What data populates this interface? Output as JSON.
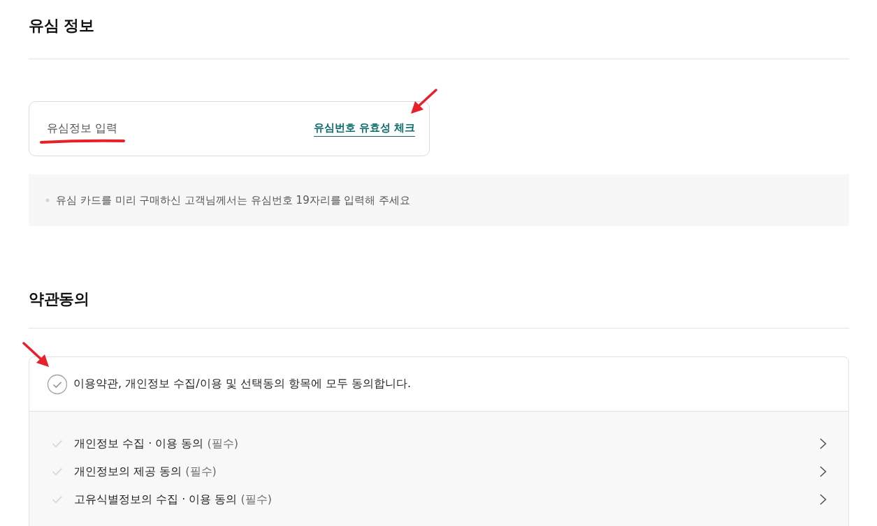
{
  "sim_section": {
    "title": "유심 정보",
    "card": {
      "label": "유심정보 입력",
      "link": "유심번호 유효성 체크"
    },
    "notice": "유심 카드를 미리 구매하신 고객님께서는 유심번호 19자리를 입력해 주세요"
  },
  "terms_section": {
    "title": "약관동의",
    "agree_all": {
      "label": "이용약관, 개인정보 수집/이용 및 선택동의 항목에 모두 동의합니다.",
      "checked": false
    },
    "items": [
      {
        "label": "개인정보 수집 · 이용 동의",
        "tag": "(필수)",
        "checked": false
      },
      {
        "label": "개인정보의 제공 동의",
        "tag": "(필수)",
        "checked": false
      },
      {
        "label": "고유식별정보의 수집 · 이용 동의",
        "tag": "(필수)",
        "checked": false
      }
    ]
  },
  "annotations": [
    {
      "kind": "underline"
    },
    {
      "kind": "arrow"
    },
    {
      "kind": "arrow"
    }
  ]
}
